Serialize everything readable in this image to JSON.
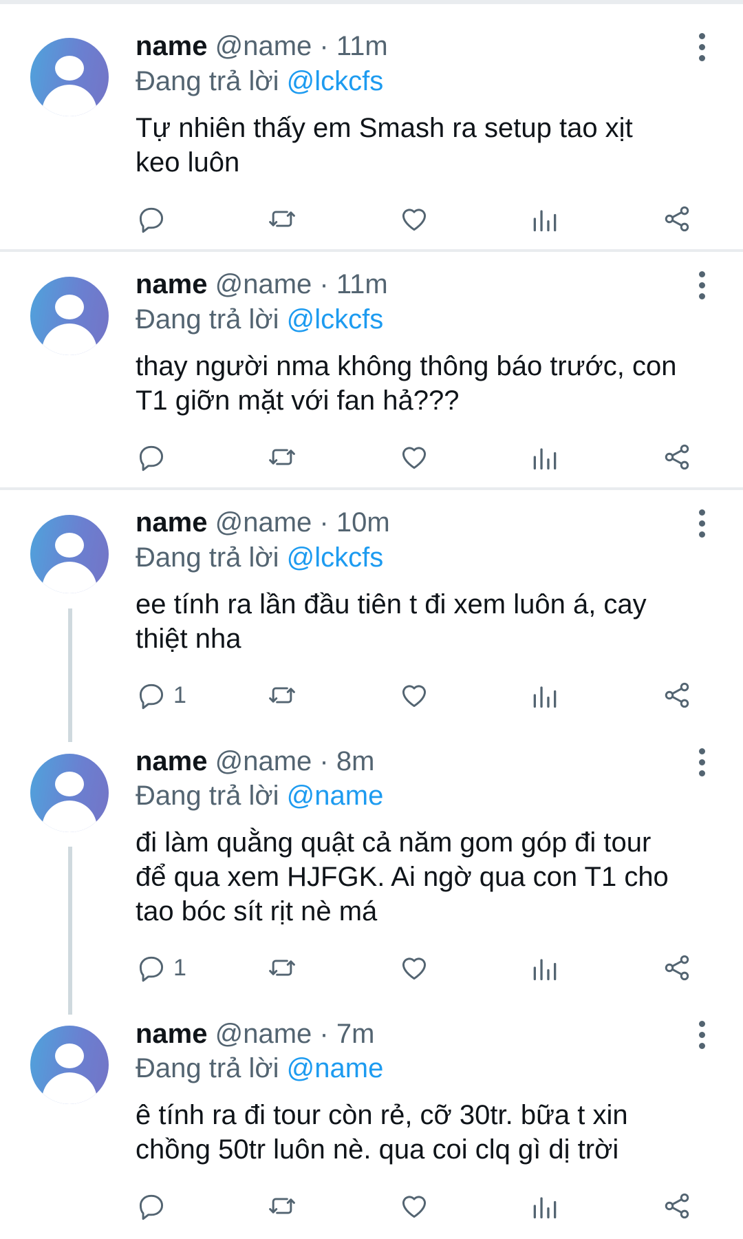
{
  "tweets": [
    {
      "name": "name",
      "handle": "@name",
      "separator": "·",
      "time": "11m",
      "reply_prefix": "Đang trả lời",
      "reply_to": "@lckcfs",
      "lines": [
        "Tự nhiên thấy em Smash ra setup tao xịt",
        "keo luôn"
      ],
      "reply_count": ""
    },
    {
      "name": "name",
      "handle": "@name",
      "separator": "·",
      "time": "11m",
      "reply_prefix": "Đang trả lời",
      "reply_to": "@lckcfs",
      "lines": [
        "thay người nma không thông báo trước, con",
        "T1 giỡn mặt với fan hả???"
      ],
      "reply_count": ""
    },
    {
      "name": "name",
      "handle": "@name",
      "separator": "·",
      "time": "10m",
      "reply_prefix": "Đang trả lời",
      "reply_to": "@lckcfs",
      "lines": [
        "ee tính ra lần đầu tiên t đi xem luôn á, cay",
        "thiệt nha"
      ],
      "reply_count": "1"
    },
    {
      "name": "name",
      "handle": "@name",
      "separator": "·",
      "time": "8m",
      "reply_prefix": "Đang trả lời",
      "reply_to": "@name",
      "lines": [
        "đi làm quằng quật cả năm gom góp đi tour",
        "để qua xem HJFGK. Ai ngờ qua con T1 cho",
        "tao bóc sít rịt nè má"
      ],
      "reply_count": "1"
    },
    {
      "name": "name",
      "handle": "@name",
      "separator": "·",
      "time": "7m",
      "reply_prefix": "Đang trả lời",
      "reply_to": "@name",
      "lines": [
        "ê tính ra đi tour còn rẻ, cỡ 30tr. bữa t xin",
        "chồng 50tr luôn nè. qua coi clq gì dị trời"
      ],
      "reply_count": ""
    }
  ],
  "icons": {
    "reply": "reply-icon",
    "retweet": "retweet-icon",
    "like": "heart-icon",
    "views": "analytics-icon",
    "share": "share-icon",
    "more": "more-vertical-icon"
  },
  "colors": {
    "mention": "#1d9bf0",
    "secondary": "#536471",
    "icon": "#536471",
    "thread_line": "#cfd9de"
  }
}
